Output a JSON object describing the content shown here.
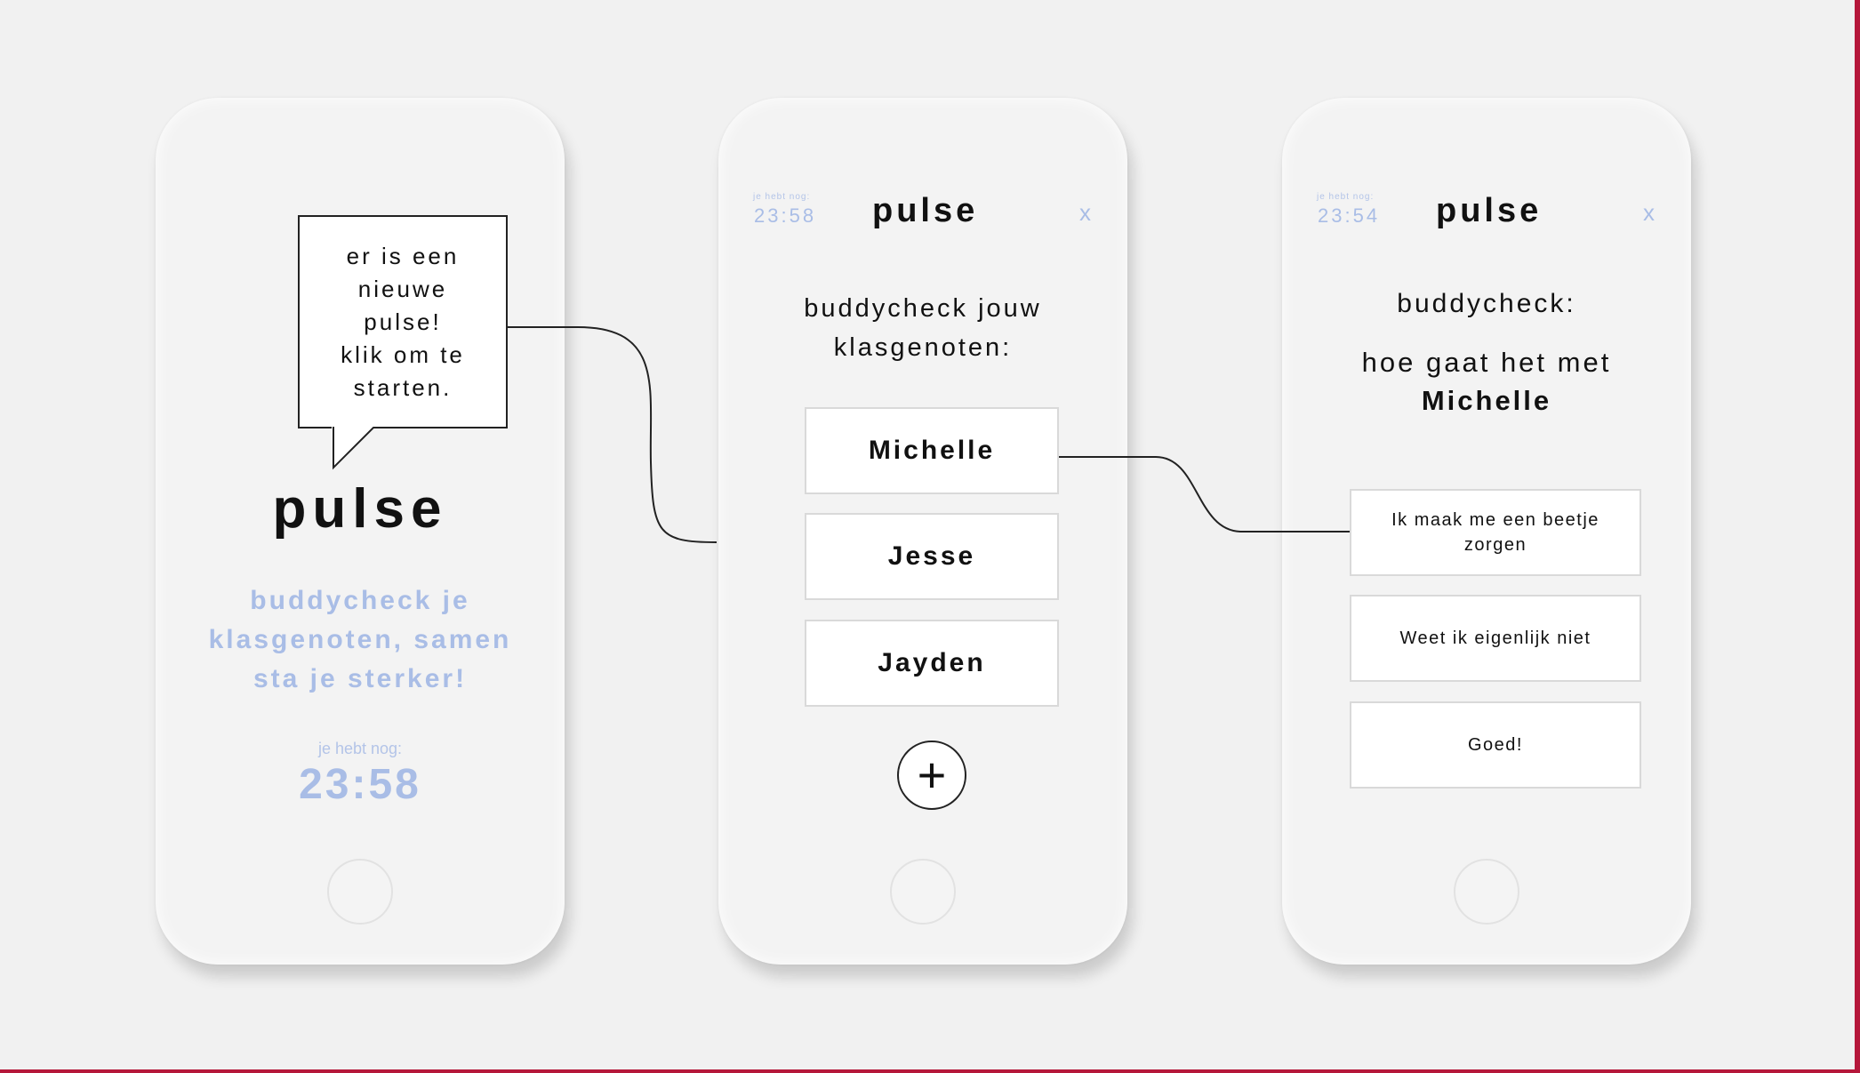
{
  "accent_color": "#a9bde6",
  "frame_color": "#b5173a",
  "screen1": {
    "bubble_text": "er is een\nnieuwe\npulse!\nklik om te\nstarten.",
    "logo": "pulse",
    "tagline": "buddycheck je\nklasgenoten, samen\nsta je sterker!",
    "remaining_label": "je hebt nog:",
    "timer": "23:58"
  },
  "screen2": {
    "remaining_label": "je hebt nog:",
    "timer": "23:58",
    "logo": "pulse",
    "close": "x",
    "heading": "buddycheck jouw\nklasgenoten:",
    "names": [
      "Michelle",
      "Jesse",
      "Jayden"
    ],
    "add_icon": "plus-icon",
    "add_symbol": "+"
  },
  "screen3": {
    "remaining_label": "je hebt nog:",
    "timer": "23:54",
    "logo": "pulse",
    "close": "x",
    "heading": "buddycheck:",
    "question": "hoe gaat het met",
    "name": "Michelle",
    "options": [
      "Ik maak me een beetje zorgen",
      "Weet ik eigenlijk niet",
      "Goed!"
    ]
  }
}
